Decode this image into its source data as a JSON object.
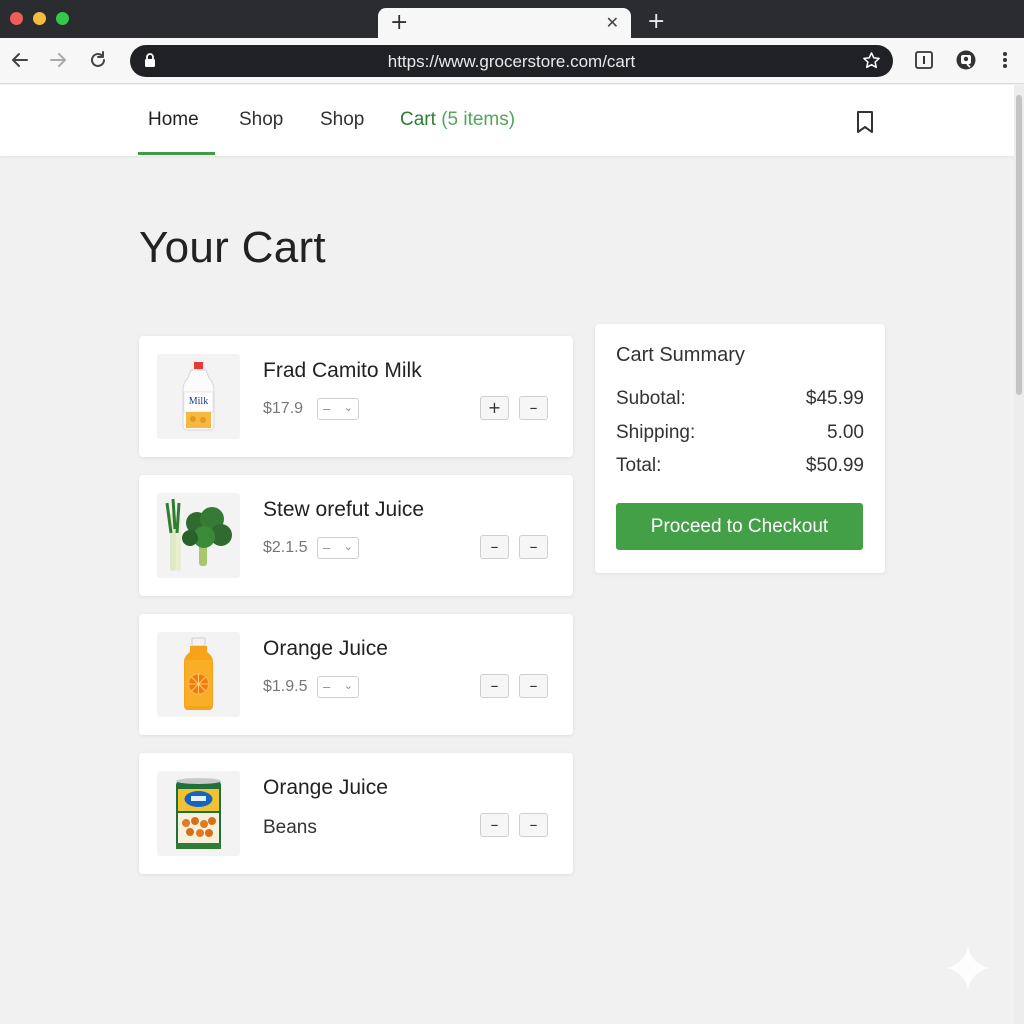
{
  "browser": {
    "url": "https://www.grocerstore.com/cart",
    "tab_plus": "+",
    "tab_close": "✕",
    "new_tab": "+"
  },
  "nav": {
    "home": "Home",
    "shop1": "Shop",
    "shop2": "Shop",
    "cart_label": "Cart",
    "cart_count": "(5 items)"
  },
  "page": {
    "title": "Your Cart"
  },
  "cart_items": [
    {
      "name": "Frad Camito Milk",
      "price": "$17.9",
      "qty_value": "–",
      "buttons": [
        "+",
        "–"
      ],
      "image_text": "Milk"
    },
    {
      "name": "Stew orefut Juice",
      "price": "$2.1.5",
      "qty_value": "–",
      "buttons": [
        "–",
        "–"
      ]
    },
    {
      "name": "Orange Juice",
      "price": "$1.9.5",
      "qty_value": "–",
      "buttons": [
        "–",
        "–"
      ]
    },
    {
      "name": "Orange Juice",
      "subtitle": "Beans",
      "buttons": [
        "–",
        "–"
      ]
    }
  ],
  "summary": {
    "title": "Cart Summary",
    "subtotal_label": "Subotal:",
    "subtotal_value": "$45.99",
    "shipping_label": "Shipping:",
    "shipping_value": "5.00",
    "total_label": "Total:",
    "total_value": "$50.99",
    "checkout_label": "Proceed to Checkout"
  },
  "colors": {
    "accent": "#43a047",
    "cart_link": "#2e7d32",
    "chrome_dark": "#2a2c30"
  },
  "icons": [
    "back-arrow-icon",
    "forward-arrow-icon",
    "reload-icon",
    "lock-icon",
    "star-icon",
    "extension-icon",
    "profile-icon",
    "more-vertical-icon",
    "bookmark-icon",
    "sparkle-icon"
  ]
}
